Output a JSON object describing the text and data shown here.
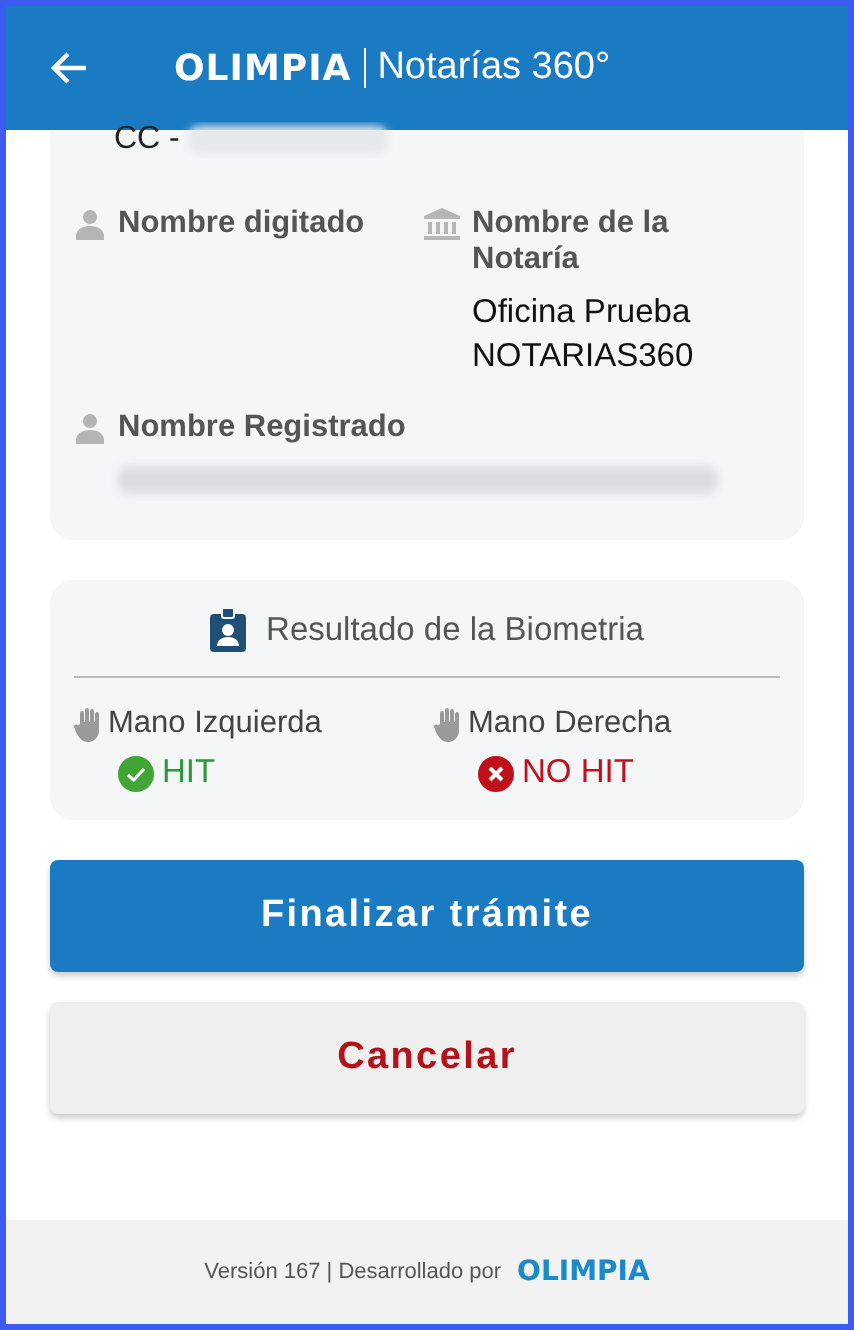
{
  "header": {
    "logo": "OLIMPIA",
    "title": "Notarías 360°"
  },
  "person": {
    "document_prefix": "CC -",
    "fields": [
      {
        "label": "Nombre digitado",
        "kind": "person"
      },
      {
        "label": "Nombre de la Notaría",
        "kind": "bank",
        "value": "Oficina Prueba NOTARIAS360"
      },
      {
        "label": "Nombre Registrado",
        "kind": "person",
        "redacted": true
      }
    ]
  },
  "biometry": {
    "title": "Resultado de la Biometria",
    "hands": [
      {
        "label": "Mano Izquierda",
        "kind": "hit",
        "result": "HIT"
      },
      {
        "label": "Mano Derecha",
        "kind": "no_hit",
        "result": "NO HIT"
      }
    ]
  },
  "buttons": [
    {
      "label": "Finalizar trámite",
      "kind": "primary"
    },
    {
      "label": "Cancelar",
      "kind": "secondary"
    }
  ],
  "footer": {
    "text": "Versión 167 | Desarrollado por",
    "logo": "OLIMPIA"
  }
}
